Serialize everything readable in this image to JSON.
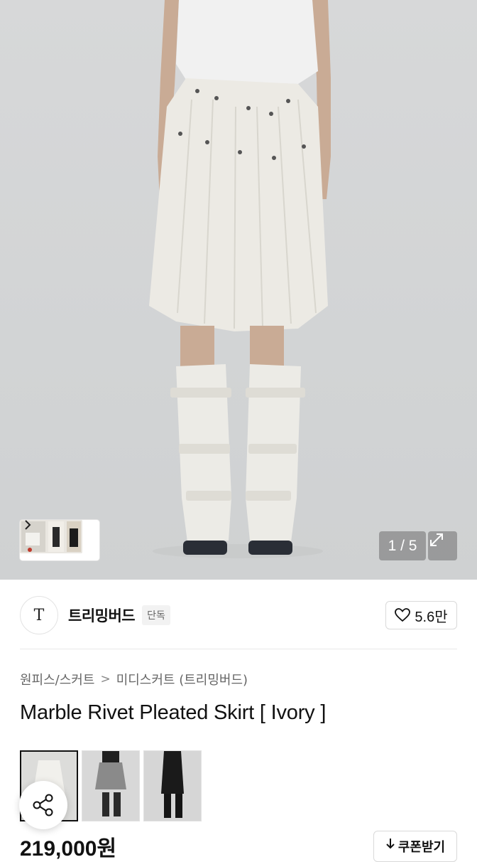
{
  "gallery": {
    "counter": "1 / 5",
    "expand_icon": "expand-icon",
    "chevron_icon": "chevron-right-icon"
  },
  "brand": {
    "logo_text": "T",
    "name": "트리밍버드",
    "badge": "단독"
  },
  "like": {
    "icon": "heart-icon",
    "count": "5.6만"
  },
  "breadcrumb": {
    "category": "원피스/스커트",
    "separator": ">",
    "subcategory": "미디스커트 (트리밍버드)"
  },
  "product": {
    "title": "Marble Rivet Pleated Skirt [ Ivory ]",
    "price": "219,000원"
  },
  "swatches": [
    {
      "color": "Ivory",
      "hex": "#e9e8e3"
    },
    {
      "color": "Gray",
      "hex": "#8c8c8c"
    },
    {
      "color": "Black",
      "hex": "#1a1a1a"
    }
  ],
  "coupon": {
    "icon": "download-arrow-icon",
    "label": "쿠폰받기"
  },
  "share": {
    "icon": "share-icon"
  }
}
